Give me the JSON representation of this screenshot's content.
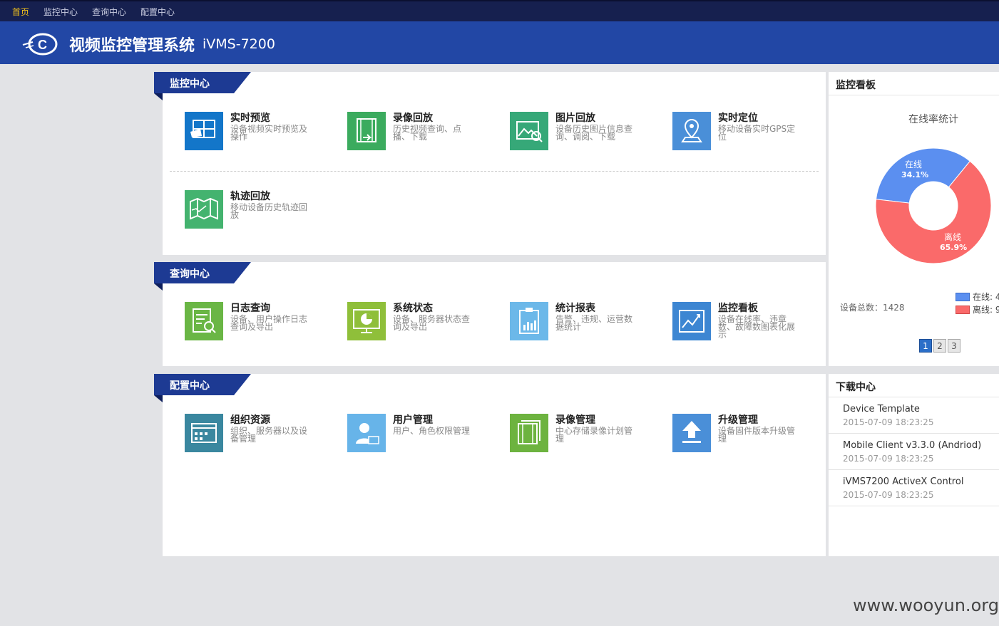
{
  "topnav": {
    "items": [
      "首页",
      "监控中心",
      "查询中心",
      "配置中心"
    ]
  },
  "header": {
    "title": "视频监控管理系统",
    "version": "iVMS-7200"
  },
  "sections": [
    {
      "title": "监控中心",
      "items": [
        {
          "title": "实时预览",
          "desc": "设备视频实时预览及操作",
          "icon": "live-preview-icon",
          "color": "#1376c9"
        },
        {
          "title": "录像回放",
          "desc": "历史视频查询、点播、下载",
          "icon": "video-playback-icon",
          "color": "#3bab5e"
        },
        {
          "title": "图片回放",
          "desc": "设备历史图片信息查询、调阅、下载",
          "icon": "picture-playback-icon",
          "color": "#36a878"
        },
        {
          "title": "实时定位",
          "desc": "移动设备实时GPS定位",
          "icon": "location-pin-icon",
          "color": "#4a8fd8"
        },
        {
          "title": "轨迹回放",
          "desc": "移动设备历史轨迹回放",
          "icon": "map-track-icon",
          "color": "#44b36f"
        }
      ]
    },
    {
      "title": "查询中心",
      "items": [
        {
          "title": "日志查询",
          "desc": "设备、用户操作日志查询及导出",
          "icon": "log-search-icon",
          "color": "#6ab645"
        },
        {
          "title": "系统状态",
          "desc": "设备、服务器状态查询及导出",
          "icon": "system-status-icon",
          "color": "#8fbf3a"
        },
        {
          "title": "统计报表",
          "desc": "告警、违规、运营数据统计",
          "icon": "statistics-report-icon",
          "color": "#6cb8e9"
        },
        {
          "title": "监控看板",
          "desc": "设备在线率、违章数、故障数图表化展示",
          "icon": "dashboard-chart-icon",
          "color": "#3d86d2"
        }
      ]
    },
    {
      "title": "配置中心",
      "items": [
        {
          "title": "组织资源",
          "desc": "组织、服务器以及设备管理",
          "icon": "organization-resource-icon",
          "color": "#3a879f"
        },
        {
          "title": "用户管理",
          "desc": "用户、角色权限管理",
          "icon": "user-management-icon",
          "color": "#67b4e9"
        },
        {
          "title": "录像管理",
          "desc": "中心存储录像计划管理",
          "icon": "recording-management-icon",
          "color": "#6db33f"
        },
        {
          "title": "升级管理",
          "desc": "设备固件版本升级管理",
          "icon": "upgrade-icon",
          "color": "#4a8fd8"
        }
      ]
    }
  ],
  "dashboard": {
    "title": "监控看板",
    "chart_title": "在线率统计",
    "total_label": "设备总数：1428",
    "legend": [
      {
        "label": "在线: 4",
        "color": "#5b8ff0"
      },
      {
        "label": "离线: 9",
        "color": "#fa6a6a"
      }
    ],
    "pages": [
      "1",
      "2",
      "3"
    ]
  },
  "chart_data": {
    "type": "pie",
    "title": "在线率统计",
    "slices": [
      {
        "label": "在线",
        "pct_label": "34.1%",
        "value": 34.1,
        "color": "#5b8ff0"
      },
      {
        "label": "离线",
        "pct_label": "65.9%",
        "value": 65.9,
        "color": "#fa6a6a"
      }
    ]
  },
  "downloads": {
    "title": "下载中心",
    "items": [
      {
        "name": "Device Template",
        "date": "2015-07-09 18:23:25"
      },
      {
        "name": "Mobile Client v3.3.0 (Andriod)",
        "date": "2015-07-09 18:23:25"
      },
      {
        "name": "iVMS7200 ActiveX Control",
        "date": "2015-07-09 18:23:25"
      }
    ]
  },
  "watermark": "www.wooyun.org"
}
